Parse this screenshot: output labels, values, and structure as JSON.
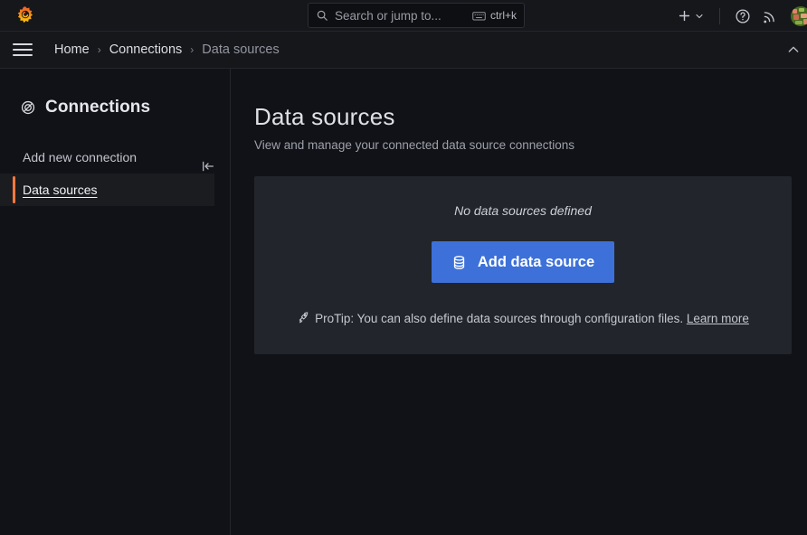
{
  "topbar": {
    "logo_name": "grafana-logo",
    "search": {
      "placeholder": "Search or jump to...",
      "shortcut": "ctrl+k",
      "icon": "search-icon",
      "kbd_icon": "keyboard-icon"
    },
    "actions": {
      "new_label": "",
      "new_icon": "plus-icon",
      "new_chevron_icon": "chevron-down-icon",
      "help_icon": "help-circle-icon",
      "news_icon": "rss-feed-icon",
      "avatar_icon": "user-avatar"
    }
  },
  "breadcrumb": {
    "menu_icon": "hamburger-menu-icon",
    "items": [
      {
        "label": "Home",
        "current": false
      },
      {
        "label": "Connections",
        "current": false
      },
      {
        "label": "Data sources",
        "current": true
      }
    ],
    "separator": "›",
    "collapse_icon": "chevron-up-icon"
  },
  "sidepane": {
    "collapse_icon": "collapse-pane-icon",
    "title": "Connections",
    "title_icon": "connections-icon",
    "items": [
      {
        "label": "Add new connection",
        "active": false
      },
      {
        "label": "Data sources",
        "active": true
      }
    ],
    "accent_color": "#ff7941"
  },
  "main": {
    "title": "Data sources",
    "subtitle": "View and manage your connected data source connections",
    "card": {
      "empty_message": "No data sources defined",
      "add_button": {
        "label": "Add data source",
        "icon": "database-icon",
        "color": "#3d71d9"
      },
      "protip": {
        "icon": "rocket-icon",
        "text": "ProTip: You can also define data sources through configuration files.",
        "link_label": "Learn more"
      }
    }
  }
}
